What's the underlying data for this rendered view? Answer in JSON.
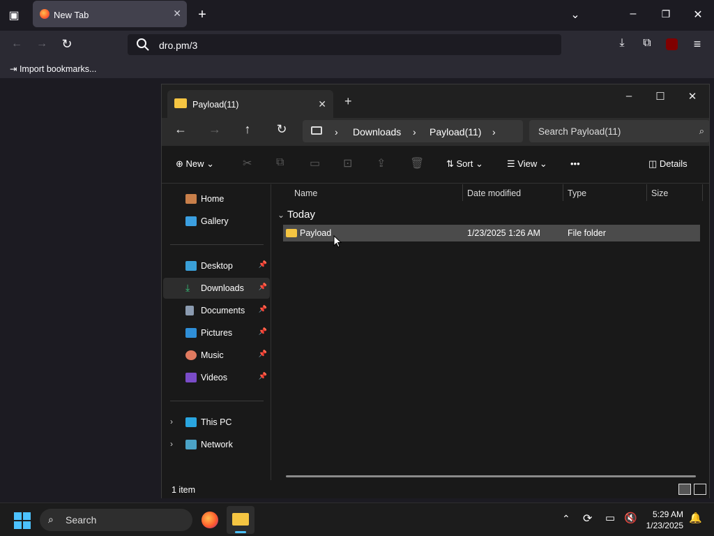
{
  "browser": {
    "tab_title": "New Tab",
    "url": "dro.pm/3",
    "bookmark_import": "Import bookmarks..."
  },
  "explorer": {
    "tab_title": "Payload(11)",
    "breadcrumb": [
      "Downloads",
      "Payload(11)"
    ],
    "search_placeholder": "Search Payload(11)",
    "commands": {
      "new": "New",
      "sort": "Sort",
      "view": "View",
      "more": "•••",
      "details": "Details"
    },
    "sidebar": [
      {
        "label": "Home",
        "pinned": false
      },
      {
        "label": "Gallery",
        "pinned": false
      },
      {
        "label": "Desktop",
        "pinned": true
      },
      {
        "label": "Downloads",
        "pinned": true,
        "selected": true
      },
      {
        "label": "Documents",
        "pinned": true
      },
      {
        "label": "Pictures",
        "pinned": true
      },
      {
        "label": "Music",
        "pinned": true
      },
      {
        "label": "Videos",
        "pinned": true
      },
      {
        "label": "This PC",
        "pinned": false
      },
      {
        "label": "Network",
        "pinned": false
      }
    ],
    "columns": [
      "Name",
      "Date modified",
      "Type",
      "Size"
    ],
    "group_label": "Today",
    "rows": [
      {
        "name": "Payload",
        "date": "1/23/2025 1:26 AM",
        "type": "File folder",
        "size": ""
      }
    ],
    "status": "1 item"
  },
  "taskbar": {
    "search_placeholder": "Search",
    "time": "5:29 AM",
    "date": "1/23/2025"
  },
  "colors": {
    "folder": "#f5c542",
    "selected_row": "#4b4b4b",
    "accent": "#0078d4"
  }
}
